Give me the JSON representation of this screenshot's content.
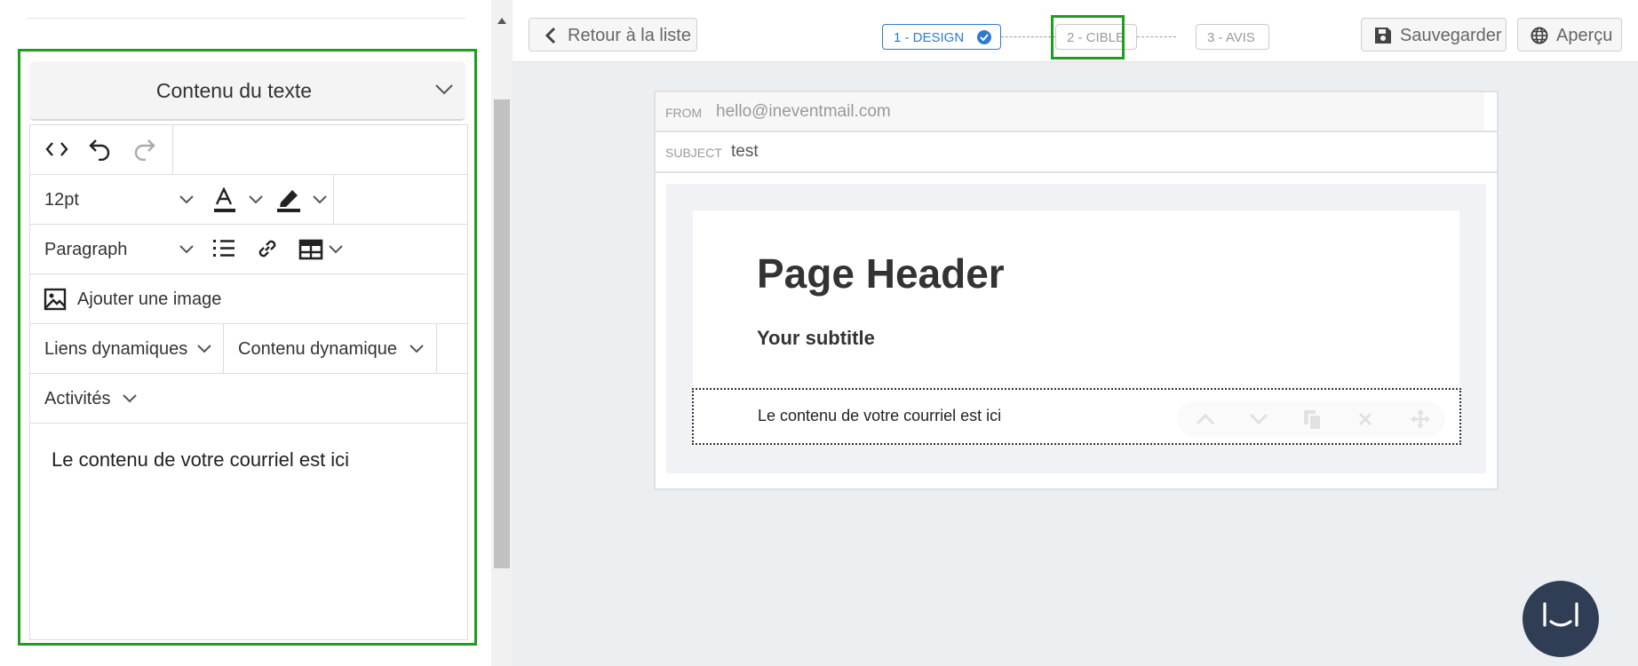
{
  "left_panel": {
    "section_title": "Contenu du texte",
    "toolbar": {
      "font_size": "12pt",
      "block_format": "Paragraph",
      "add_image_label": "Ajouter une image",
      "dynamic_links_label": "Liens dynamiques",
      "dynamic_content_label": "Contenu dynamique",
      "activities_label": "Activités"
    },
    "editor_content": "Le contenu de votre courriel est ici"
  },
  "top_bar": {
    "back_label": "Retour à la liste",
    "steps": [
      {
        "label": "1 - DESIGN",
        "state": "completed"
      },
      {
        "label": "2 - CIBLE",
        "state": "pending"
      },
      {
        "label": "3 - AVIS",
        "state": "pending"
      }
    ],
    "save_label": "Sauvegarder",
    "preview_label": "Aperçu"
  },
  "email": {
    "from_label": "FROM",
    "from_value": "hello@ineventmail.com",
    "subject_label": "SUBJECT",
    "subject_value": "test",
    "header_title": "Page Header",
    "header_subtitle": "Your subtitle",
    "body_text": "Le contenu de votre courriel est ici"
  },
  "colors": {
    "highlight": "#1e9e1e",
    "accent": "#2d7bd0",
    "chat": "#2f3e55"
  }
}
